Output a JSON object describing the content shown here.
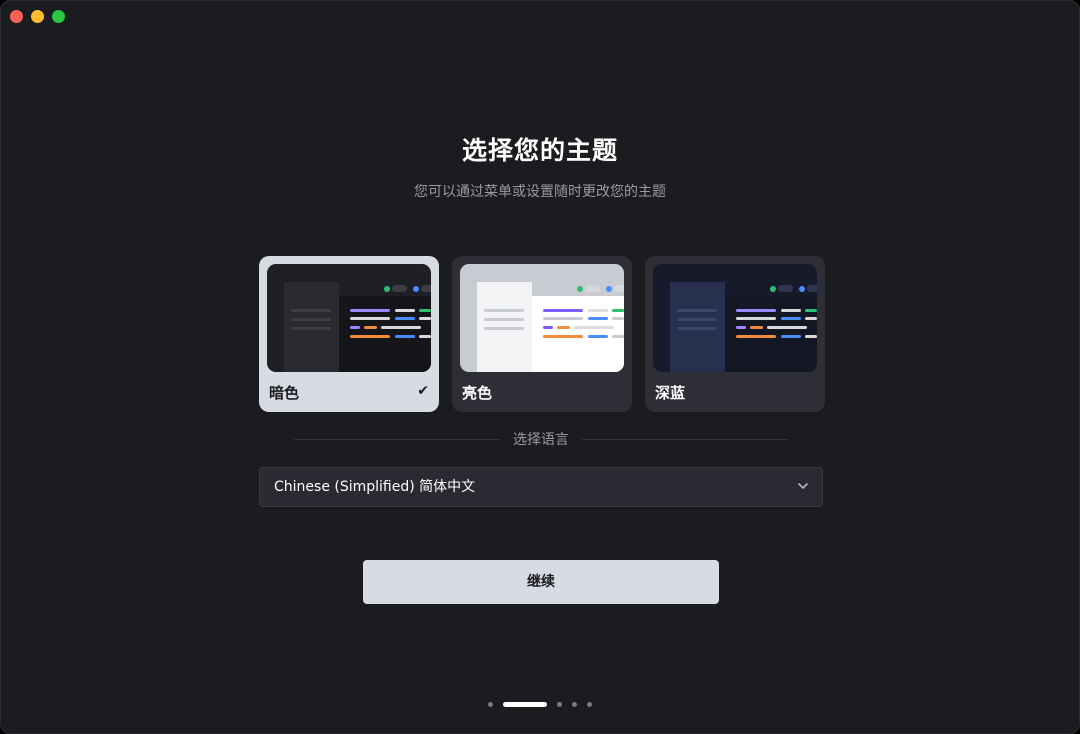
{
  "window": {
    "traffic_lights": [
      "close",
      "minimize",
      "maximize"
    ]
  },
  "header": {
    "title": "选择您的主题",
    "subtitle": "您可以通过菜单或设置随时更改您的主题"
  },
  "themes": [
    {
      "label": "暗色",
      "selected": true,
      "check_icon": "✔"
    },
    {
      "label": "亮色",
      "selected": false
    },
    {
      "label": "深蓝",
      "selected": false
    }
  ],
  "language": {
    "section_label": "选择语言",
    "selected_value": "Chinese (Simplified) 简体中文"
  },
  "actions": {
    "continue_label": "继续"
  },
  "pager": {
    "total_steps": 5,
    "current_step": 2
  },
  "colors": {
    "window_bg": "#1b1c20",
    "card_bg": "#2d2e36",
    "selected_card_bg": "#d9dbe4",
    "button_bg": "#d9dbe4",
    "accent_purple": "#7c5cff",
    "accent_orange": "#f08a3c",
    "accent_blue": "#4a8cff",
    "accent_green": "#2fbf71"
  }
}
